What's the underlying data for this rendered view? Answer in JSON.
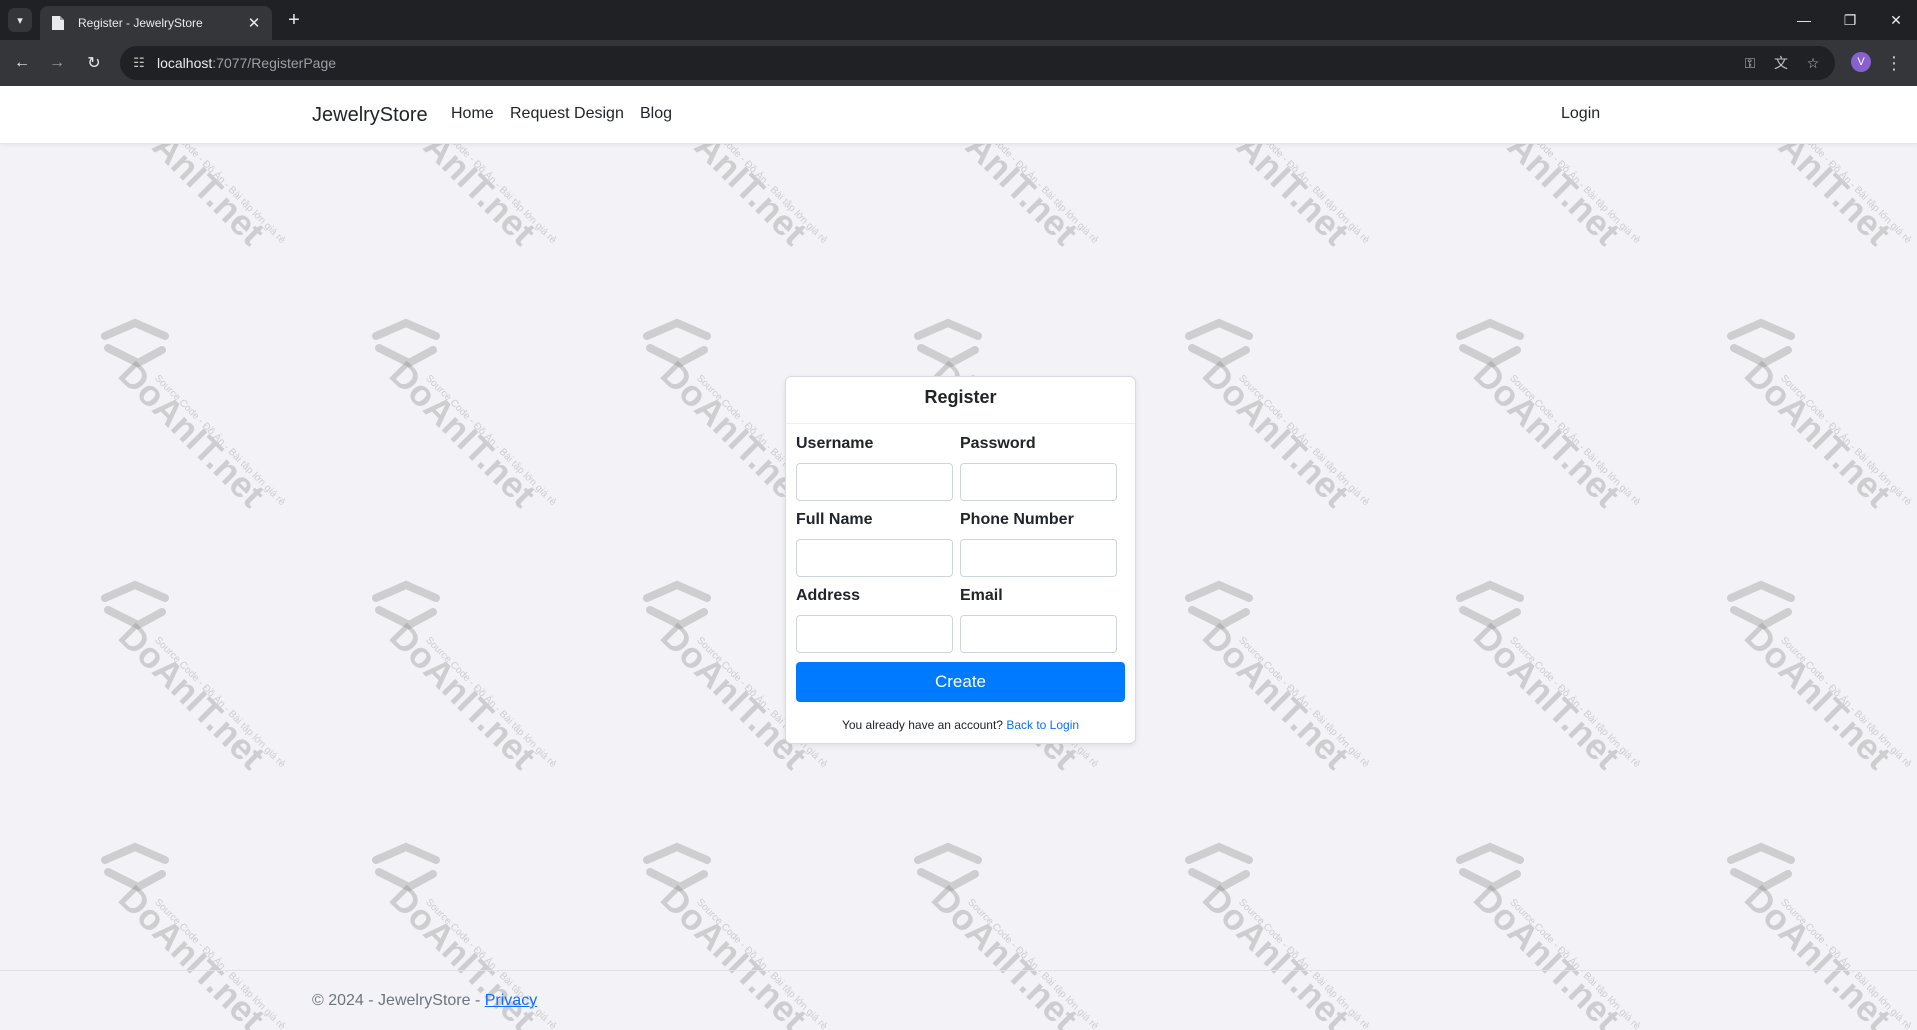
{
  "browser": {
    "tab_title": "Register - JewelryStore",
    "url_host": "localhost",
    "url_rest": ":7077/RegisterPage",
    "profile_initial": "V"
  },
  "navbar": {
    "brand": "JewelryStore",
    "links": [
      "Home",
      "Request Design",
      "Blog"
    ],
    "login": "Login"
  },
  "register": {
    "title": "Register",
    "fields": [
      {
        "label": "Username",
        "value": ""
      },
      {
        "label": "Password",
        "value": ""
      },
      {
        "label": "Full Name",
        "value": ""
      },
      {
        "label": "Phone Number",
        "value": ""
      },
      {
        "label": "Address",
        "value": ""
      },
      {
        "label": "Email",
        "value": ""
      }
    ],
    "submit_label": "Create",
    "account_prompt": "You already have an account?",
    "back_link": "Back to Login"
  },
  "footer": {
    "text": "© 2024 - JewelryStore - ",
    "privacy": "Privacy"
  },
  "watermark": {
    "text": "DoAnIT.net",
    "subtext": "Source Code - Đồ Án - Bài tập lớn giá rẻ"
  },
  "colors": {
    "primary": "#007bff",
    "link": "#0d6efd",
    "page_bg": "#f3f2f7"
  }
}
